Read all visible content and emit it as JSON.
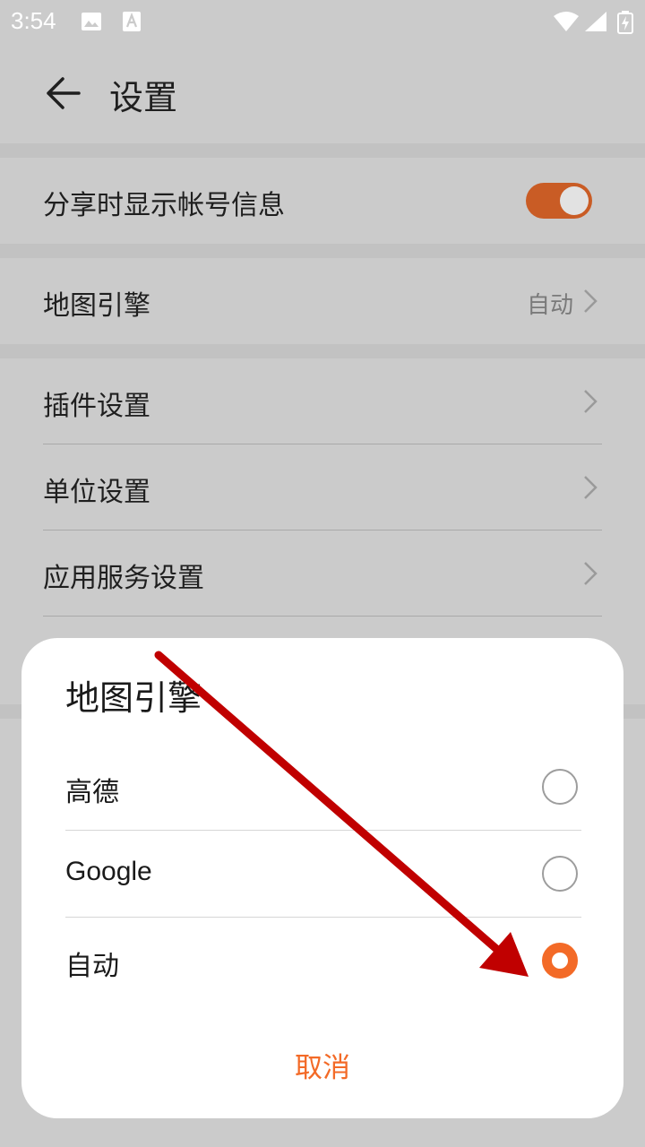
{
  "status_bar": {
    "time": "3:54",
    "icons": [
      "image-icon",
      "a-text-icon",
      "wifi-icon",
      "signal-icon",
      "battery-icon"
    ]
  },
  "header": {
    "title": "设置",
    "back_icon": "arrow-left-icon"
  },
  "settings": {
    "share_account": {
      "label": "分享时显示帐号信息",
      "toggle_on": true
    },
    "map_engine": {
      "label": "地图引擎",
      "value": "自动"
    },
    "list": [
      {
        "label": "插件设置"
      },
      {
        "label": "单位设置"
      },
      {
        "label": "应用服务设置"
      }
    ]
  },
  "dialog": {
    "title": "地图引擎",
    "options": [
      {
        "label": "高德",
        "selected": false
      },
      {
        "label": "Google",
        "selected": false
      },
      {
        "label": "自动",
        "selected": true
      }
    ],
    "cancel_label": "取消"
  },
  "colors": {
    "accent": "#f36a27",
    "toggle": "#c95c25",
    "annotation_arrow": "#c00000"
  }
}
